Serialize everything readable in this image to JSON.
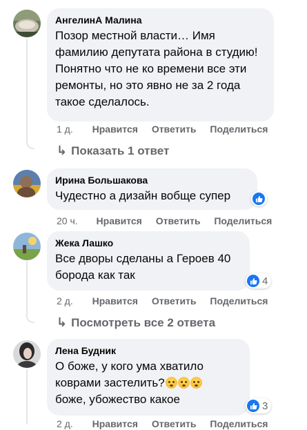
{
  "comments": [
    {
      "author": "АнгелинА Малина",
      "text": "Позор местной власти… Имя фамилию депутата района в студию! Понятно что не ко времени все эти ремонты, но это явно не за 2 года такое сделалось.",
      "time": "1 д.",
      "like_label": "Нравится",
      "reply_label": "Ответить",
      "share_label": "Поделиться",
      "replies_link": "Показать 1 ответ"
    },
    {
      "author": "Ирина Большакова",
      "text": "Чудестно а дизайн вобще супер",
      "time": "20 ч.",
      "like_label": "Нравится",
      "reply_label": "Ответить",
      "share_label": "Поделиться",
      "reactions": {
        "icon": "like-icon"
      }
    },
    {
      "author": "Жека Лашко",
      "text": "Все дворы сделаны а Героев 40 борода как так",
      "time": "2 д.",
      "like_label": "Нравится",
      "reply_label": "Ответить",
      "share_label": "Поделиться",
      "reactions": {
        "icon": "like-icon",
        "count": "4"
      },
      "replies_link": "Посмотреть все 2 ответа"
    },
    {
      "author": "Лена Будник",
      "text_lines": [
        "О боже, у кого ума хватило",
        "коврами застелить?",
        "боже, убожество какое"
      ],
      "emoji": "flushed-face-emoji",
      "time": "2 д.",
      "like_label": "Нравится",
      "reply_label": "Ответить",
      "share_label": "Поделиться",
      "reactions": {
        "icon": "like-icon",
        "count": "3"
      }
    }
  ],
  "colors": {
    "bubble": "#f0f2f5",
    "meta": "#65676b",
    "like": "#1877f2",
    "thread_line": "#e4e6eb"
  }
}
